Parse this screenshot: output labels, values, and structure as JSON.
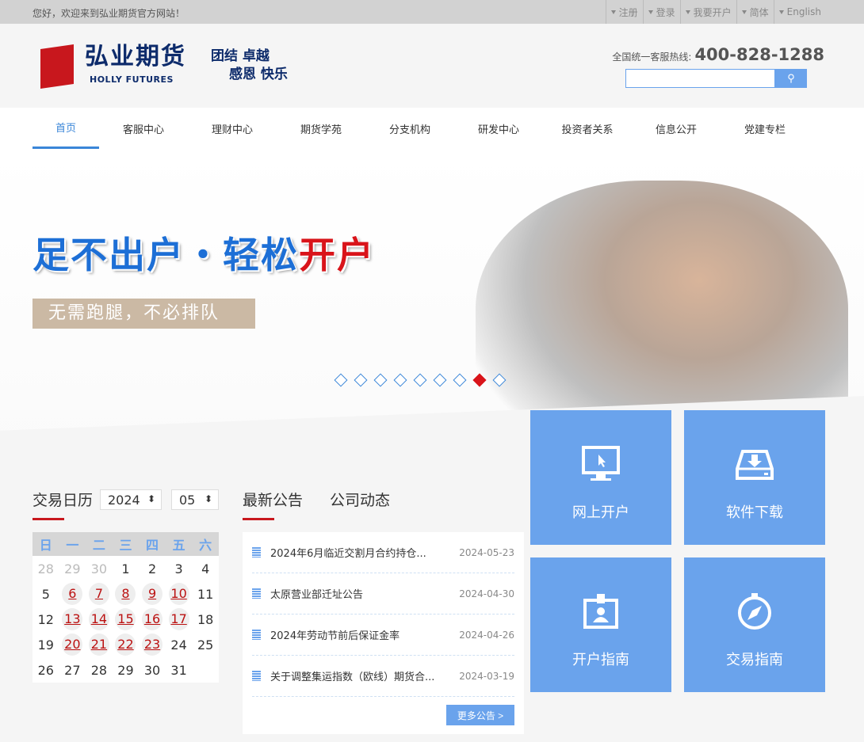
{
  "topbar": {
    "welcome": "您好，欢迎来到弘业期货官方网站！",
    "links": [
      "注册",
      "登录",
      "我要开户",
      "简体",
      "English"
    ]
  },
  "header": {
    "logo_cn": "弘业期货",
    "logo_en": "HOLLY FUTURES",
    "slogan": [
      "团结  卓越",
      "感恩  快乐"
    ],
    "hotline_label": "全国统一客服热线:",
    "hotline": "400-828-1288",
    "search_placeholder": ""
  },
  "nav": [
    "首页",
    "客服中心",
    "理财中心",
    "期货学苑",
    "分支机构",
    "研发中心",
    "投资者关系",
    "信息公开",
    "党建专栏"
  ],
  "nav_active": 0,
  "banner": {
    "headline_a": "足不出户・轻松",
    "headline_b": "开户",
    "sub": "无需跑腿，不必排队",
    "slides": 9,
    "active_slide": 8
  },
  "tiles": [
    {
      "label": "网上开户",
      "icon": "monitor-cursor-icon"
    },
    {
      "label": "软件下载",
      "icon": "download-drive-icon"
    },
    {
      "label": "开户指南",
      "icon": "id-badge-icon"
    },
    {
      "label": "交易指南",
      "icon": "compass-icon"
    }
  ],
  "calendar": {
    "title": "交易日历",
    "year": "2024",
    "month": "05",
    "weekdays": [
      "日",
      "一",
      "二",
      "三",
      "四",
      "五",
      "六"
    ],
    "weeks": [
      [
        "28",
        "29",
        "30",
        "1",
        "2",
        "3",
        "4"
      ],
      [
        "5",
        "6",
        "7",
        "8",
        "9",
        "10",
        "11"
      ],
      [
        "12",
        "13",
        "14",
        "15",
        "16",
        "17",
        "18"
      ],
      [
        "19",
        "20",
        "21",
        "22",
        "23",
        "24",
        "25"
      ],
      [
        "26",
        "27",
        "28",
        "29",
        "30",
        "31",
        ""
      ]
    ],
    "trading_days": [
      "6",
      "7",
      "8",
      "9",
      "10",
      "13",
      "14",
      "15",
      "16",
      "17",
      "20",
      "21",
      "22",
      "23"
    ]
  },
  "notices": {
    "tabs": [
      "最新公告",
      "公司动态"
    ],
    "items": [
      {
        "title": "2024年6月临近交割月合约持仓...",
        "date": "2024-05-23"
      },
      {
        "title": "太原营业部迁址公告",
        "date": "2024-04-30"
      },
      {
        "title": "2024年劳动节前后保证金率",
        "date": "2024-04-26"
      },
      {
        "title": "关于调整集运指数（欧线）期货合...",
        "date": "2024-03-19"
      }
    ],
    "more": "更多公告 >"
  },
  "colors": {
    "accent": "#6aa3ec",
    "brand_red": "#c8171d",
    "nav_active": "#3a86d8"
  }
}
